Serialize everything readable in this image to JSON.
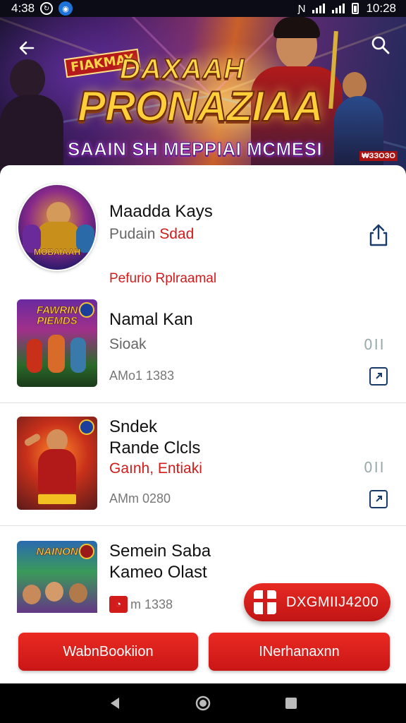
{
  "status_bar": {
    "time_left": "4:38",
    "time_right": "10:28"
  },
  "banner": {
    "kicker": "FIAKMAY",
    "line1": "DAXAAH",
    "line2": "PRONAZIAA",
    "line3": "SAAIN SH MEPPIAI MCMESI",
    "rating": "₩ЗЗОЗО"
  },
  "profile": {
    "name": "Maadda Kays",
    "sub_gray": "Pudain",
    "sub_red": "Sdad",
    "section_link": "Pefurio Rplraamal",
    "avatar_caption": "MOBAIAAH"
  },
  "items": [
    {
      "title_lines": [
        "Namal Kan"
      ],
      "sub": "Sioak",
      "meta": "AMo1 1383",
      "thumb_caption": "FAWRIN PIEMDS",
      "toggle": "0II"
    },
    {
      "title_lines": [
        "Sndek",
        "Rande Clcls"
      ],
      "sub": "Gaınh, Entiaki",
      "meta": "AMm 0280",
      "thumb_caption": "",
      "toggle": "0II"
    },
    {
      "title_lines": [
        "Semein Saba",
        "Kameo Olast"
      ],
      "sub": "",
      "meta": "m 1338",
      "thumb_caption": "NAINON",
      "toggle": ""
    }
  ],
  "float_button": {
    "label": "DXGMIIJ4200"
  },
  "actions": {
    "left": "WabnBookiion",
    "right": "INerhanaxnn"
  },
  "colors": {
    "accent_red": "#d21b1b",
    "status_bar_bg": "#0c0c16"
  }
}
